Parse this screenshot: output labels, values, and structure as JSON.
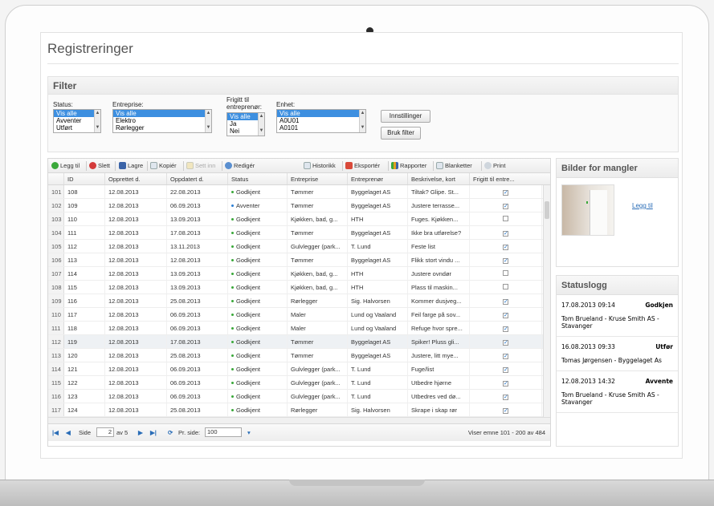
{
  "page": {
    "title": "Registreringer"
  },
  "filter": {
    "title": "Filter",
    "status": {
      "label": "Status:",
      "options": [
        "Vis alle",
        "Avventer",
        "Utført"
      ]
    },
    "entreprise": {
      "label": "Entreprise:",
      "options": [
        "Vis alle",
        "Elektro",
        "Rørlegger"
      ]
    },
    "frigitt": {
      "label_line1": "Frigitt til",
      "label_line2": "entreprenør:",
      "options": [
        "Vis alle",
        "Ja",
        "Nei"
      ]
    },
    "enhet": {
      "label": "Enhet:",
      "options": [
        "Vis alle",
        "A0U01",
        "A0101"
      ]
    },
    "settings_button": "Innstillinger",
    "apply_button": "Bruk filter"
  },
  "toolbar": {
    "add": "Legg til",
    "delete": "Slett",
    "save": "Lagre",
    "copy": "Kopiér",
    "set_in": "Sett inn",
    "edit": "Redigér",
    "history": "Historikk",
    "export": "Eksportér",
    "reports": "Rapporter",
    "forms": "Blanketter",
    "print": "Print"
  },
  "grid": {
    "columns": [
      "ID",
      "Opprettet d.",
      "Oppdatert d.",
      "Status",
      "Entreprise",
      "Entreprenør",
      "Beskrivelse, kort",
      "Frigitt til entre..."
    ],
    "rows": [
      {
        "n": "101",
        "id": "108",
        "created": "12.08.2013",
        "updated": "22.08.2013",
        "status": "Godkjent",
        "ent": "Tømmer",
        "contractor": "Byggelaget AS",
        "desc": "Tiltak? Glipe. St...",
        "released": true
      },
      {
        "n": "102",
        "id": "109",
        "created": "12.08.2013",
        "updated": "06.09.2013",
        "status": "Avventer",
        "ent": "Tømmer",
        "contractor": "Byggelaget AS",
        "desc": "Justere terrasse...",
        "released": true
      },
      {
        "n": "103",
        "id": "110",
        "created": "12.08.2013",
        "updated": "13.09.2013",
        "status": "Godkjent",
        "ent": "Kjøkken, bad, g...",
        "contractor": "HTH",
        "desc": "Fuges. Kjøkken...",
        "released": false
      },
      {
        "n": "104",
        "id": "111",
        "created": "12.08.2013",
        "updated": "17.08.2013",
        "status": "Godkjent",
        "ent": "Tømmer",
        "contractor": "Byggelaget AS",
        "desc": "Ikke bra utførelse?",
        "released": true
      },
      {
        "n": "105",
        "id": "112",
        "created": "12.08.2013",
        "updated": "13.11.2013",
        "status": "Godkjent",
        "ent": "Gulvlegger (park...",
        "contractor": "T. Lund",
        "desc": "Feste list",
        "released": true
      },
      {
        "n": "106",
        "id": "113",
        "created": "12.08.2013",
        "updated": "12.08.2013",
        "status": "Godkjent",
        "ent": "Tømmer",
        "contractor": "Byggelaget AS",
        "desc": "Flikk stort vindu ...",
        "released": true
      },
      {
        "n": "107",
        "id": "114",
        "created": "12.08.2013",
        "updated": "13.09.2013",
        "status": "Godkjent",
        "ent": "Kjøkken, bad, g...",
        "contractor": "HTH",
        "desc": "Justere ovndør",
        "released": false
      },
      {
        "n": "108",
        "id": "115",
        "created": "12.08.2013",
        "updated": "13.09.2013",
        "status": "Godkjent",
        "ent": "Kjøkken, bad, g...",
        "contractor": "HTH",
        "desc": "Plass til maskin...",
        "released": false
      },
      {
        "n": "109",
        "id": "116",
        "created": "12.08.2013",
        "updated": "25.08.2013",
        "status": "Godkjent",
        "ent": "Rørlegger",
        "contractor": "Sig. Halvorsen",
        "desc": "Kommer dusjveg...",
        "released": true
      },
      {
        "n": "110",
        "id": "117",
        "created": "12.08.2013",
        "updated": "06.09.2013",
        "status": "Godkjent",
        "ent": "Maler",
        "contractor": "Lund og Vaaland",
        "desc": "Feil farge på sov...",
        "released": true
      },
      {
        "n": "111",
        "id": "118",
        "created": "12.08.2013",
        "updated": "06.09.2013",
        "status": "Godkjent",
        "ent": "Maler",
        "contractor": "Lund og Vaaland",
        "desc": "Refuge hvor spre...",
        "released": true
      },
      {
        "n": "112",
        "id": "119",
        "created": "12.08.2013",
        "updated": "17.08.2013",
        "status": "Godkjent",
        "ent": "Tømmer",
        "contractor": "Byggelaget AS",
        "desc": "Spiker! Pluss gli...",
        "released": true
      },
      {
        "n": "113",
        "id": "120",
        "created": "12.08.2013",
        "updated": "25.08.2013",
        "status": "Godkjent",
        "ent": "Tømmer",
        "contractor": "Byggelaget AS",
        "desc": "Justere, litt mye...",
        "released": true
      },
      {
        "n": "114",
        "id": "121",
        "created": "12.08.2013",
        "updated": "06.09.2013",
        "status": "Godkjent",
        "ent": "Gulvlegger (park...",
        "contractor": "T. Lund",
        "desc": "Fuge/list",
        "released": true
      },
      {
        "n": "115",
        "id": "122",
        "created": "12.08.2013",
        "updated": "06.09.2013",
        "status": "Godkjent",
        "ent": "Gulvlegger (park...",
        "contractor": "T. Lund",
        "desc": "Utbedre hjørne",
        "released": true
      },
      {
        "n": "116",
        "id": "123",
        "created": "12.08.2013",
        "updated": "06.09.2013",
        "status": "Godkjent",
        "ent": "Gulvlegger (park...",
        "contractor": "T. Lund",
        "desc": "Utbedres ved dø...",
        "released": true
      },
      {
        "n": "117",
        "id": "124",
        "created": "12.08.2013",
        "updated": "25.08.2013",
        "status": "Godkjent",
        "ent": "Rørlegger",
        "contractor": "Sig. Halvorsen",
        "desc": "Skrape i skap rør",
        "released": true
      }
    ]
  },
  "pager": {
    "page_label": "Side",
    "page_value": "2",
    "of_label": "av 5",
    "per_page_label": "Pr. side:",
    "per_page_value": "100",
    "range_text": "Viser emne 101 - 200 av 484"
  },
  "images_panel": {
    "title": "Bilder for mangler",
    "add_link": "Legg til"
  },
  "status_log": {
    "title": "Statuslogg",
    "entries": [
      {
        "time": "17.08.2013 09:14",
        "status": "Godkjen",
        "who": "Tom Brueland - Kruse Smith AS - Stavanger"
      },
      {
        "time": "16.08.2013 09:33",
        "status": "Utfør",
        "who": "Tomas Jørgensen - Byggelaget As"
      },
      {
        "time": "12.08.2013 14:32",
        "status": "Avvente",
        "who": "Tom Brueland - Kruse Smith AS - Stavanger"
      }
    ]
  },
  "colors": {
    "godkjent_dot": "#3aa83a",
    "avventer_dot": "#2a7fd4",
    "selection": "#3d8fe0",
    "link": "#2a6db7"
  }
}
